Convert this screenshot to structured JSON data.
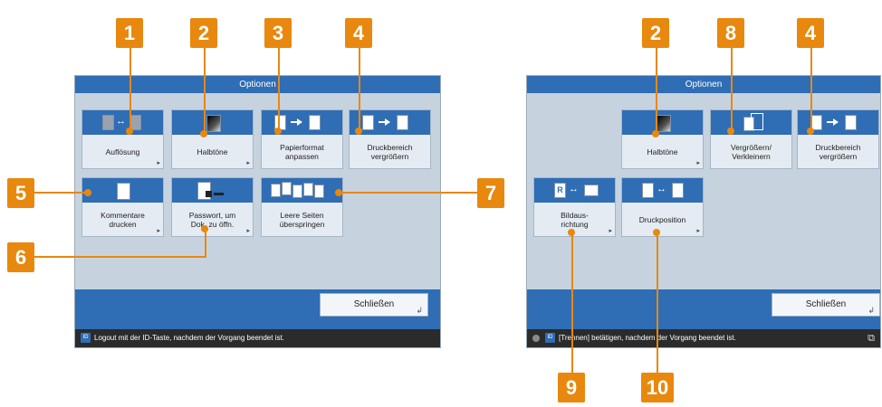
{
  "left_panel": {
    "title": "Optionen",
    "buttons": [
      {
        "label": "Auflösung",
        "icon": "resolution-icon"
      },
      {
        "label": "Halbtöne",
        "icon": "halftone-icon"
      },
      {
        "label": "Papierformat\nanpassen",
        "icon": "fit-paper-icon"
      },
      {
        "label": "Druckbereich\nvergrößern",
        "icon": "enlarge-print-area-icon"
      },
      {
        "label": "Kommentare\ndrucken",
        "icon": "comments-icon"
      },
      {
        "label": "Passwort, um\nDok. zu öffn.",
        "icon": "password-lock-icon"
      },
      {
        "label": "Leere Seiten\nüberspringen",
        "icon": "skip-blank-pages-icon"
      }
    ],
    "close_label": "Schließen",
    "status": "Logout mit der ID-Taste, nachdem der Vorgang beendet ist."
  },
  "right_panel": {
    "title": "Optionen",
    "buttons": [
      {
        "label": "Halbtöne",
        "icon": "halftone-icon"
      },
      {
        "label": "Vergrößern/\nVerkleinern",
        "icon": "zoom-icon"
      },
      {
        "label": "Druckbereich\nvergrößern",
        "icon": "enlarge-print-area-icon"
      },
      {
        "label": "Bildaus-\nrichtung",
        "icon": "image-orientation-icon"
      },
      {
        "label": "Druckposition",
        "icon": "print-position-icon"
      }
    ],
    "close_label": "Schließen",
    "status": "[Trennen] betätigen, nachdem der Vorgang beendet ist."
  },
  "callouts": [
    "1",
    "2",
    "3",
    "4",
    "5",
    "6",
    "7",
    "2",
    "8",
    "4",
    "9",
    "10"
  ],
  "colors": {
    "accent": "#2f6db5",
    "callout": "#e8880e",
    "panel": "#c6d3df",
    "statusbar": "#2b2b2b"
  }
}
